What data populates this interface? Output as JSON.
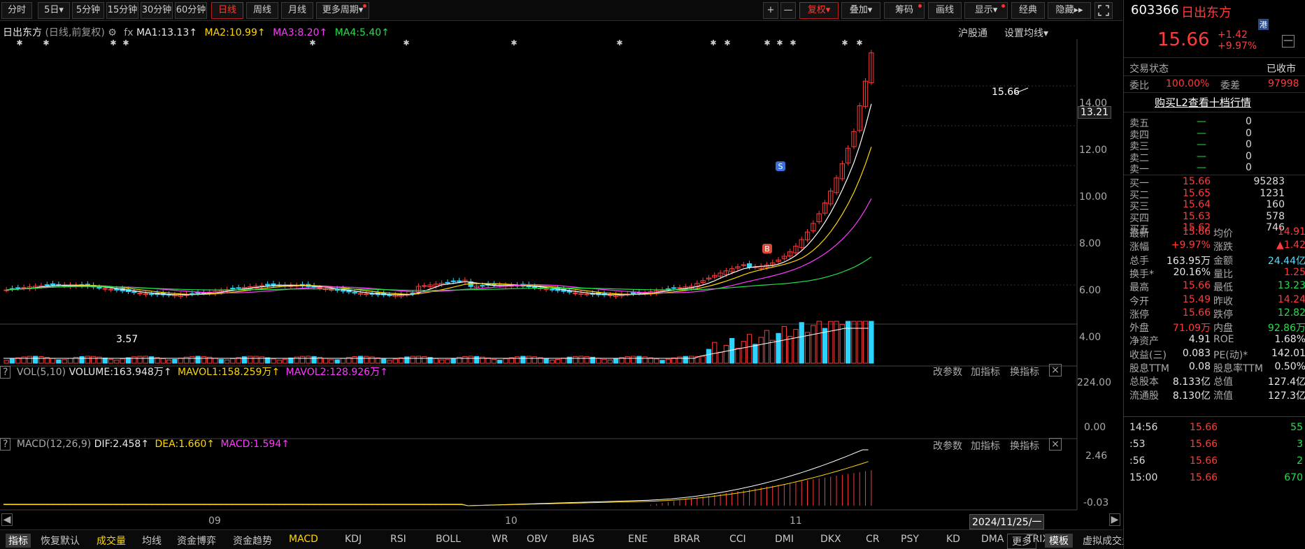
{
  "toolbar": {
    "items": [
      {
        "label": "分时"
      },
      {
        "label": "5日▾"
      },
      {
        "label": "5分钟"
      },
      {
        "label": "15分钟"
      },
      {
        "label": "30分钟"
      },
      {
        "label": "60分钟"
      },
      {
        "label": "日线"
      },
      {
        "label": "周线"
      },
      {
        "label": "月线"
      },
      {
        "label": "更多周期▾"
      }
    ],
    "right": [
      {
        "label": "+"
      },
      {
        "label": "—"
      },
      {
        "label": "复权▾"
      },
      {
        "label": "叠加▾"
      },
      {
        "label": "筹码"
      },
      {
        "label": "画线"
      },
      {
        "label": "显示▾"
      },
      {
        "label": "经典"
      },
      {
        "label": "隐藏▸▸"
      }
    ],
    "fullscreen_icon": "expand-icon"
  },
  "main": {
    "stock_name": "日出东方",
    "mode": "(日线,前复权)",
    "ma1": "MA1:13.13",
    "ma2": "MA2:10.99",
    "ma3": "MA3:8.20",
    "ma4": "MA4:5.40",
    "hugutong": "沪股通",
    "set_ma": "设置均线▾",
    "high_label": "15.66",
    "low_label": "3.57",
    "last_price_tag": "13.21",
    "y_ticks": [
      "14.00",
      "12.00",
      "10.00",
      "8.00",
      "6.00",
      "4.00"
    ],
    "sell_mark": "S",
    "buy_mark": "B"
  },
  "vol": {
    "title": "VOL(5,10)",
    "volume": "VOLUME:163.948万",
    "mavol1": "MAVOL1:158.259万",
    "mavol2": "MAVOL2:128.926万",
    "change_params": "改参数",
    "add_ind": "加指标",
    "switch_ind": "换指标",
    "y_top": "224.00",
    "y_bot": "0.00"
  },
  "macd": {
    "title": "MACD(12,26,9)",
    "dif": "DIF:2.458",
    "dea": "DEA:1.660",
    "macd": "MACD:1.594",
    "change_params": "改参数",
    "add_ind": "加指标",
    "switch_ind": "换指标",
    "y_top": "2.46",
    "y_bot": "-0.03"
  },
  "x_axis": {
    "labels": [
      "09",
      "10",
      "11"
    ],
    "date_cursor": "2024/11/25/一"
  },
  "bottom": {
    "items": [
      "指标",
      "恢复默认",
      "成交量",
      "均线",
      "资金博弈",
      "资金趋势",
      "MACD",
      "KDJ",
      "RSI",
      "BOLL",
      "WR",
      "OBV",
      "BIAS",
      "ENE",
      "BRAR",
      "CCI",
      "DMI",
      "DKX",
      "CR",
      "PSY",
      "KD",
      "DMA",
      "TRIX",
      "虚拟成交量"
    ],
    "more": "更多",
    "template": "模板"
  },
  "side": {
    "code": "603366",
    "name": "日出东方",
    "hk_badge": "港",
    "price": "15.66",
    "change": "+1.42",
    "pct": "+9.97%",
    "status_label": "交易状态",
    "status_value": "已收市",
    "weibi_label": "委比",
    "weibi": "100.00%",
    "weicha_label": "委差",
    "weicha": "97998",
    "l2": "购买L2查看十档行情",
    "sells": [
      {
        "label": "卖五",
        "price": "—",
        "vol": "0"
      },
      {
        "label": "卖四",
        "price": "—",
        "vol": "0"
      },
      {
        "label": "卖三",
        "price": "—",
        "vol": "0"
      },
      {
        "label": "卖二",
        "price": "—",
        "vol": "0"
      },
      {
        "label": "卖一",
        "price": "—",
        "vol": "0"
      }
    ],
    "buys": [
      {
        "label": "买一",
        "price": "15.66",
        "vol": "95283"
      },
      {
        "label": "买二",
        "price": "15.65",
        "vol": "1231"
      },
      {
        "label": "买三",
        "price": "15.64",
        "vol": "160"
      },
      {
        "label": "买四",
        "price": "15.63",
        "vol": "578"
      },
      {
        "label": "买五",
        "price": "15.62",
        "vol": "746"
      }
    ],
    "stats": [
      [
        "最新",
        "15.66",
        "均价",
        "14.91"
      ],
      [
        "涨幅",
        "+9.97%",
        "涨跌",
        "▲1.42"
      ],
      [
        "总手",
        "163.95万",
        "金额",
        "24.44亿"
      ],
      [
        "换手*",
        "20.16%",
        "量比",
        "1.25"
      ],
      [
        "最高",
        "15.66",
        "最低",
        "13.23"
      ],
      [
        "今开",
        "15.49",
        "昨收",
        "14.24"
      ],
      [
        "涨停",
        "15.66",
        "跌停",
        "12.82"
      ],
      [
        "外盘",
        "71.09万",
        "内盘",
        "92.86万"
      ],
      [
        "净资产",
        "4.91",
        "ROE",
        "1.68%"
      ],
      [
        "收益(三)",
        "0.083",
        "PE(动)*",
        "142.01"
      ],
      [
        "股息TTM",
        "0.08",
        "股息率TTM",
        "0.50%"
      ],
      [
        "总股本",
        "8.133亿",
        "总值",
        "127.4亿"
      ],
      [
        "流通股",
        "8.130亿",
        "流值",
        "127.3亿"
      ]
    ],
    "ticks": [
      {
        "time": "14:56",
        "price": "15.66",
        "vol": "55"
      },
      {
        "time": ":53",
        "price": "15.66",
        "vol": "3"
      },
      {
        "time": ":56",
        "price": "15.66",
        "vol": "2"
      },
      {
        "time": "15:00",
        "price": "15.66",
        "vol": "670"
      }
    ]
  },
  "colors": {
    "up": "#ff3b3b",
    "down": "#22e04a",
    "ma1": "#ffffff",
    "ma2": "#ffd800",
    "ma3": "#ff3bff",
    "ma4": "#22e04a"
  }
}
